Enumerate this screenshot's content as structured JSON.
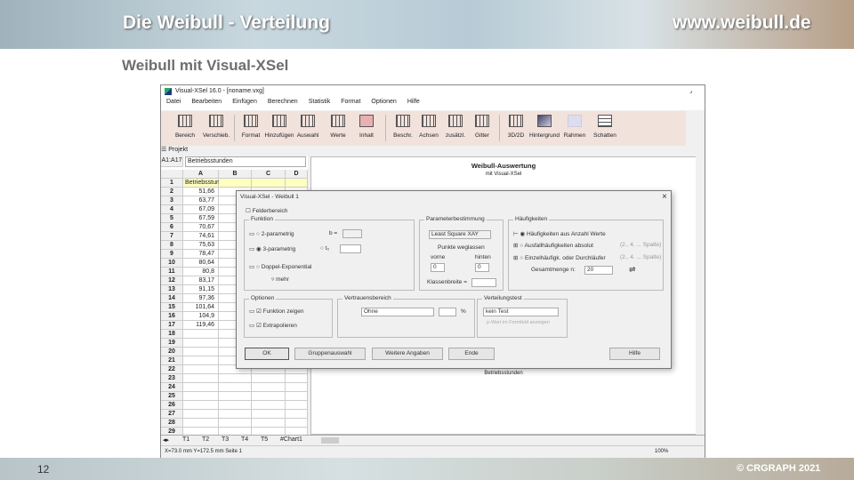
{
  "slide": {
    "title": "Die Weibull - Verteilung",
    "url": "www.weibull.de",
    "subtitle": "Weibull mit Visual-XSel",
    "page_number": "12",
    "copyright": "© CRGRAPH 2021"
  },
  "app": {
    "title": "Visual-XSel 16.0 - [noname.vxg]",
    "menu": [
      "Datei",
      "Bearbeiten",
      "Einfügen",
      "Berechnen",
      "Statistik",
      "Format",
      "Optionen",
      "Hilfe"
    ],
    "toolbar": [
      "Bereich",
      "Verschieb.",
      "Format",
      "Hinzufügen",
      "Auswahl",
      "Werte",
      "Inhalt",
      "Beschr.",
      "Achsen",
      "zusätzl.",
      "Gitter",
      "3D/2D",
      "Hintergrund",
      "Rahmen",
      "Schatten"
    ],
    "project_label": "Projekt",
    "cell_ref": "A1:A17",
    "cell_value": "Betriebsstunden",
    "columns": [
      "A",
      "B",
      "C",
      "D"
    ],
    "rows": [
      "Betriebsstunden",
      "51,66",
      "63,77",
      "67,09",
      "67,59",
      "70,67",
      "74,61",
      "75,63",
      "78,47",
      "80,64",
      "80,8",
      "83,17",
      "91,15",
      "97,36",
      "101,64",
      "104,9",
      "119,46",
      "",
      "",
      "",
      "",
      "",
      "",
      "",
      "",
      "",
      "",
      "",
      ""
    ],
    "sheet_tabs": [
      "T1",
      "T2",
      "T3",
      "T4",
      "T5",
      "#Chart1"
    ],
    "chart": {
      "title": "Weibull-Auswertung",
      "subtitle": "mit Visual-XSel",
      "xlabel": "Betriebsstunden"
    },
    "status": {
      "coords": "X=73.0 mm  Y=172.5 mm  Seite 1",
      "zoom": "100%"
    }
  },
  "dialog": {
    "title": "Visual-XSel - Weibull 1",
    "close": "×",
    "checkbox_top": "Felderbereich",
    "funktion": {
      "label": "Funktion",
      "opt1": "2-parametrig",
      "opt2": "3-parametrig",
      "opt3": "Doppel-Exponential",
      "b_label": "b =",
      "t0_label": "t₀",
      "mehr": "mehr"
    },
    "param": {
      "label": "Parameterbestimmung",
      "method": "Least Square XAY",
      "punkte": "Punkte weglassen",
      "vorne": "vorne",
      "hinten": "hinten",
      "vorne_val": "0",
      "hinten_val": "0",
      "klassen": "Klassenbreite ="
    },
    "haeuf": {
      "label": "Häufigkeiten",
      "opt1": "Häufigkeiten aus Anzahl Werte",
      "opt2": "Ausfallhäufigkeiten absolut",
      "opt3": "Einzelhäufigk. oder Durchläufer",
      "hint2": "(2., 4. ... Spalte)",
      "hint3": "(2., 4. ... Spalte)",
      "gesamt": "Gesamtmenge n:",
      "gesamt_val": "20"
    },
    "optionen": {
      "label": "Optionen",
      "opt1": "Funktion zeigen",
      "opt2": "Extrapolieren"
    },
    "vertrauen": {
      "label": "Vertrauensbereich",
      "value": "Ohne",
      "percent": "%"
    },
    "test": {
      "label": "Verteilungstest",
      "value": "kein Test",
      "hint": "p-Wert im Formfeld anzeigen"
    },
    "buttons": {
      "ok": "OK",
      "gruppen": "Gruppenauswahl",
      "weitere": "Weitere Angaben",
      "ende": "Ende",
      "hilfe": "Hilfe"
    }
  }
}
